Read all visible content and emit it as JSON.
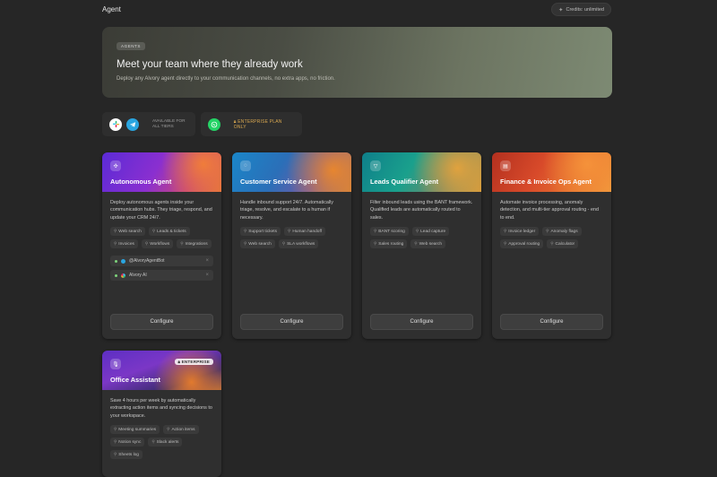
{
  "header": {
    "title": "Agent",
    "credits": "Credits: unlimited"
  },
  "hero": {
    "badge": "AGENTS",
    "title": "Meet your team where they already work",
    "subtitle": "Deploy any Alvory agent directly to your communication channels, no extra apps, no friction."
  },
  "availability": {
    "all_tiers_label_1": "AVAILABLE FOR",
    "all_tiers_label_2": "ALL TIERS",
    "enterprise_label": "ENTERPRISE PLAN ONLY"
  },
  "agents": [
    {
      "title": "Autonomous Agent",
      "description": "Deploy autonomous agents inside your communication hubs. They triage, respond, and update your CRM 24/7.",
      "tags": [
        "Web search",
        "Leads & tickets",
        "Invoices",
        "Workflows",
        "Integrations"
      ],
      "bots": [
        "@AlvoryAgentBot",
        "Alvory AI"
      ],
      "configure": "Configure"
    },
    {
      "title": "Customer Service Agent",
      "description": "Handle inbound support 24/7. Automatically triage, resolve, and escalate to a human if necessary.",
      "tags": [
        "Support tickets",
        "Human handoff",
        "Web search",
        "SLA workflows"
      ],
      "configure": "Configure"
    },
    {
      "title": "Leads Qualifier Agent",
      "description": "Filter inbound leads using the BANT framework. Qualified leads are automatically routed to sales.",
      "tags": [
        "BANT scoring",
        "Lead capture",
        "Sales routing",
        "Web search"
      ],
      "configure": "Configure"
    },
    {
      "title": "Finance & Invoice Ops Agent",
      "description": "Automate invoice processing, anomaly detection, and multi-tier approval routing - end to end.",
      "tags": [
        "Invoice ledger",
        "Anomaly flags",
        "Approval routing",
        "Calculator"
      ],
      "configure": "Configure"
    },
    {
      "title": "Office Assistant",
      "badge": "ENTERPRISE",
      "description": "Save 4 hours per week by automatically extracting action items and syncing decisions to your workspace.",
      "tags": [
        "Meeting summaries",
        "Action items",
        "Notion sync",
        "Slack alerts",
        "Sheets log"
      ]
    }
  ],
  "colors": {
    "background": "#262626",
    "card": "#2f2f2f",
    "enterprise_accent": "#d9a850"
  },
  "icons": {
    "autonomous": "network-icon",
    "customer_service": "chat-bubble-icon",
    "leads": "filter-icon",
    "finance": "document-icon",
    "office": "microphone-icon"
  }
}
